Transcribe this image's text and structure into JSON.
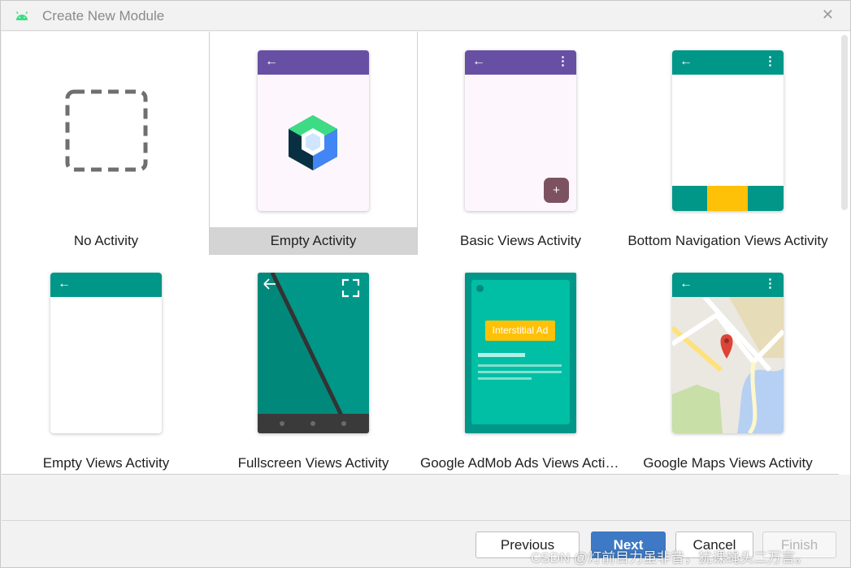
{
  "window": {
    "title": "Create New Module",
    "app_icon": "android-icon",
    "close_icon": "close-icon"
  },
  "templates": [
    {
      "label": "No Activity",
      "selected": false
    },
    {
      "label": "Empty Activity",
      "selected": true
    },
    {
      "label": "Basic Views Activity",
      "selected": false
    },
    {
      "label": "Bottom Navigation Views Activity",
      "selected": false
    },
    {
      "label": "Empty Views Activity",
      "selected": false
    },
    {
      "label": "Fullscreen Views Activity",
      "selected": false
    },
    {
      "label": "Google AdMob Ads Views Activ...",
      "selected": false
    },
    {
      "label": "Google Maps Views Activity",
      "selected": false
    }
  ],
  "admob_badge": "Interstitial Ad",
  "buttons": {
    "previous": "Previous",
    "next": "Next",
    "cancel": "Cancel",
    "finish": "Finish"
  },
  "watermark": "CSDN @灯前目力虽非昔，犹课蝇头二万言。",
  "colors": {
    "purple_appbar": "#6750a4",
    "teal": "#009688",
    "amber": "#ffc107",
    "fab": "#7d5260",
    "primary_button": "#3d79c4",
    "android_green": "#3ddc84"
  }
}
